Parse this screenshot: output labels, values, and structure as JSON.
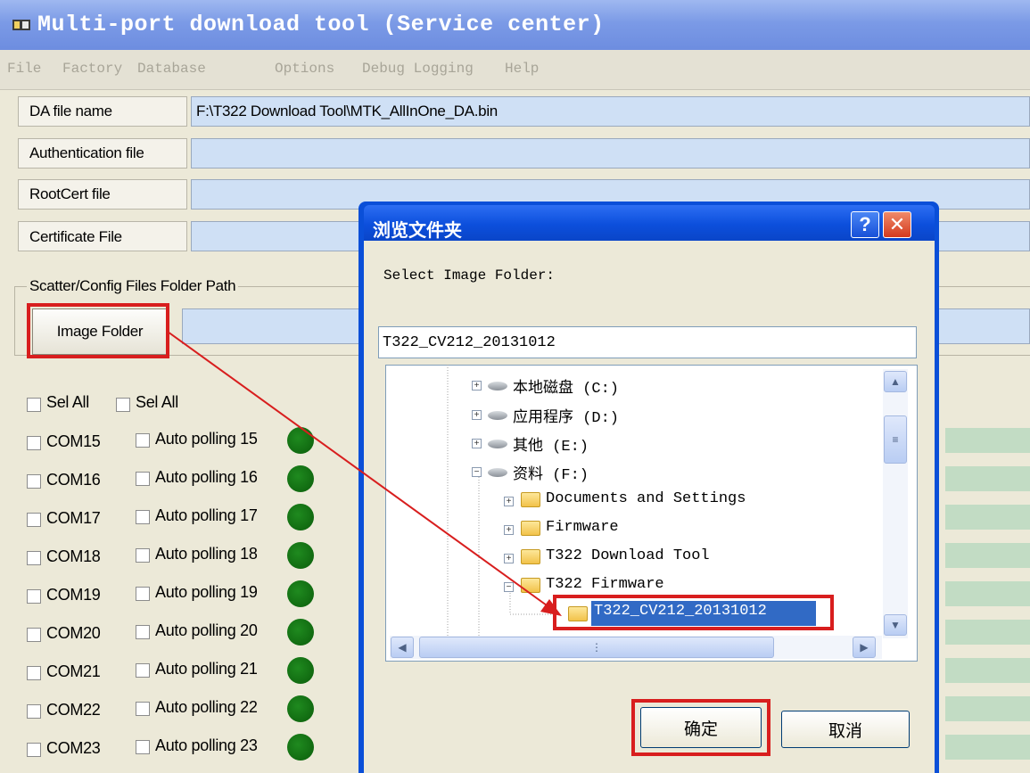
{
  "window": {
    "title": "Multi-port download tool (Service center)",
    "app_icon": "app-icon"
  },
  "menu": [
    "File",
    "Factory",
    "Database",
    "Options",
    "Debug Logging",
    "Help"
  ],
  "form": {
    "da_label": "DA file name",
    "da_value": "F:\\T322 Download Tool\\MTK_AllInOne_DA.bin",
    "auth_label": "Authentication file",
    "auth_value": "",
    "rootcert_label": "RootCert file",
    "rootcert_value": "",
    "cert_label": "Certificate File",
    "cert_value": ""
  },
  "scatter_group": {
    "label": "Scatter/Config Files Folder Path",
    "button": "Image Folder",
    "path_value": ""
  },
  "sel_all": [
    "Sel All",
    "Sel All"
  ],
  "ports": [
    {
      "com": "COM15",
      "poll": "Auto polling 15"
    },
    {
      "com": "COM16",
      "poll": "Auto polling 16"
    },
    {
      "com": "COM17",
      "poll": "Auto polling 17"
    },
    {
      "com": "COM18",
      "poll": "Auto polling 18"
    },
    {
      "com": "COM19",
      "poll": "Auto polling 19"
    },
    {
      "com": "COM20",
      "poll": "Auto polling 20"
    },
    {
      "com": "COM21",
      "poll": "Auto polling 21"
    },
    {
      "com": "COM22",
      "poll": "Auto polling 22"
    },
    {
      "com": "COM23",
      "poll": "Auto polling 23"
    }
  ],
  "dialog": {
    "title": "浏览文件夹",
    "help": "?",
    "close": "✕",
    "prompt": "Select Image Folder:",
    "folder_value": "T322_CV212_20131012",
    "tree": [
      {
        "label": "本地磁盘 (C:)",
        "type": "drive",
        "expander": "+"
      },
      {
        "label": "应用程序 (D:)",
        "type": "drive",
        "expander": "+"
      },
      {
        "label": "其他 (E:)",
        "type": "drive",
        "expander": "+"
      },
      {
        "label": "资料 (F:)",
        "type": "drive",
        "expander": "−"
      },
      {
        "label": "Documents and Settings",
        "type": "folder",
        "expander": "+"
      },
      {
        "label": "Firmware",
        "type": "folder",
        "expander": "+"
      },
      {
        "label": "T322 Download Tool",
        "type": "folder",
        "expander": "+"
      },
      {
        "label": "T322 Firmware",
        "type": "folder",
        "expander": "−"
      },
      {
        "label": "T322_CV212_20131012",
        "type": "folder",
        "expander": "",
        "selected": true
      }
    ],
    "ok": "确定",
    "cancel": "取消"
  },
  "colors": {
    "annotation_red": "#d81e1e",
    "status_green": "#0b6b0b",
    "field_blue": "#cfe0f5",
    "selection_blue": "#316ac5"
  }
}
